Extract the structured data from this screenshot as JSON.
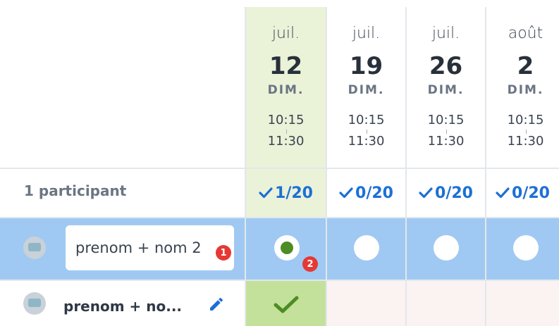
{
  "columns": [
    {
      "month": "juil.",
      "day": "12",
      "weekday": "DIM.",
      "start": "10:15",
      "end": "11:30",
      "count": "1/20",
      "selected": true
    },
    {
      "month": "juil.",
      "day": "19",
      "weekday": "DIM.",
      "start": "10:15",
      "end": "11:30",
      "count": "0/20",
      "selected": false
    },
    {
      "month": "juil.",
      "day": "26",
      "weekday": "DIM.",
      "start": "10:15",
      "end": "11:30",
      "count": "0/20",
      "selected": false
    },
    {
      "month": "août",
      "day": "2",
      "weekday": "DIM.",
      "start": "10:15",
      "end": "11:30",
      "count": "0/20",
      "selected": false
    }
  ],
  "summary": {
    "participants_label": "1 participant"
  },
  "edit_row": {
    "name_value": "prenom + nom 2",
    "badge_input": "1",
    "badge_choice": "2"
  },
  "participant": {
    "name": "prenom + no..."
  },
  "icons": {
    "check": "check-icon",
    "edit": "pencil-icon",
    "avatar": "avatar-icon"
  },
  "colors": {
    "accent": "#1d6fd6",
    "selected_column": "#eaf2d8",
    "edit_row": "#9fc9f2",
    "yes": "#c3e19b",
    "no": "#faf3f2",
    "badge": "#e53935"
  }
}
